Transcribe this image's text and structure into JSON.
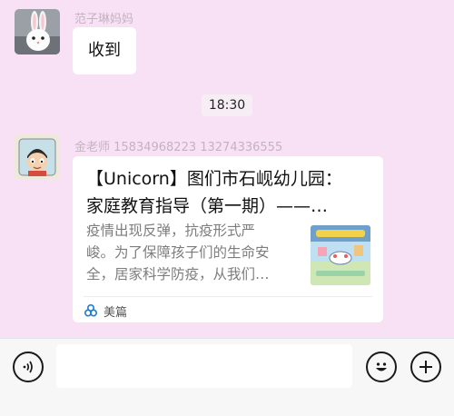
{
  "messages": [
    {
      "sender": "范子琳妈妈",
      "avatar_icon": "rabbit-avatar-icon",
      "text": "收到"
    },
    {
      "sender": "金老师 15834968223 13274336555",
      "avatar_icon": "cartoon-boy-avatar-icon",
      "card": {
        "title_line1": "【Unicorn】图们市石岘幼儿园：",
        "title_line2": "家庭教育指导（第一期）——…",
        "desc_line1": "疫情出现反弹，抗疫形式严",
        "desc_line2": "峻。为了保障孩子们的生命安",
        "desc_line3": "全，居家科学防疫，从我们…",
        "thumb_icon": "article-thumbnail-icon",
        "source_icon": "meipian-logo-icon",
        "source_label": "美篇"
      }
    }
  ],
  "time_divider": "18:30",
  "input_bar": {
    "voice_icon": "voice-icon",
    "emoji_icon": "emoji-icon",
    "plus_icon": "plus-icon",
    "input_value": ""
  },
  "colors": {
    "background": "#f9e1f5",
    "bubble": "#ffffff",
    "sender_name": "#c3b3c0",
    "input_bar": "#f7f7f7"
  }
}
